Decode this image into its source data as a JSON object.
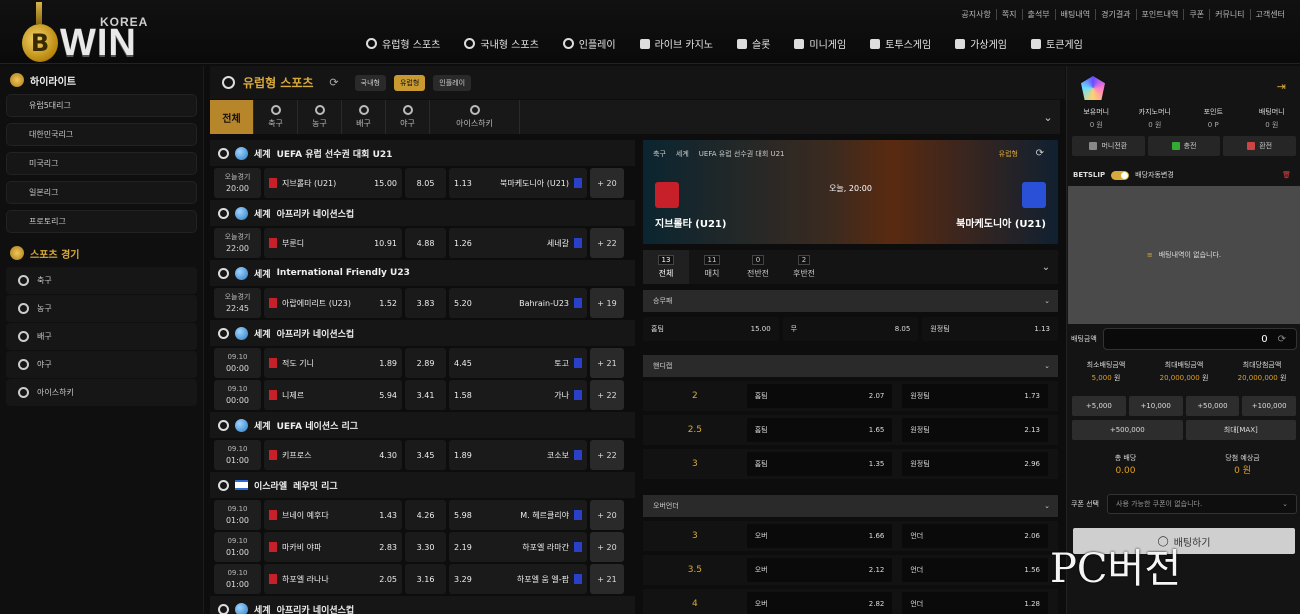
{
  "logo": {
    "badge": "B",
    "small": "KOREA",
    "big": "WIN"
  },
  "util_links": [
    "공지사항",
    "쪽지",
    "출석부",
    "배팅내역",
    "경기결과",
    "포인트내역",
    "쿠폰",
    "커뮤니티",
    "고객센터"
  ],
  "main_nav": [
    "유럽형 스포츠",
    "국내형 스포츠",
    "인플레이",
    "라이브 카지노",
    "슬롯",
    "미니게임",
    "토투스게임",
    "가상게임",
    "토큰게임"
  ],
  "sidebar": {
    "highlight_title": "하이라이트",
    "highlights": [
      "유럽5대리그",
      "대한민국리그",
      "미국리그",
      "일본리그",
      "프로토리그"
    ],
    "sports_title": "스포츠 경기",
    "sports": [
      "축구",
      "농구",
      "배구",
      "야구",
      "아이스하키"
    ]
  },
  "center": {
    "title": "유럽형 스포츠",
    "refresh": "⟳",
    "pills": [
      "국내형",
      "유럽형",
      "인플레이"
    ],
    "sport_tabs": [
      "전체",
      "축구",
      "농구",
      "배구",
      "야구",
      "아이스하키"
    ]
  },
  "leagues": [
    {
      "region": "세계",
      "name": "UEFA 유럽 선수권 대회 U21",
      "flag": "globe",
      "matches": [
        {
          "date": "오늘경기",
          "time": "20:00",
          "home": "지브롤타 (U21)",
          "h": "15.00",
          "d": "8.05",
          "a": "1.13",
          "away": "북마케도니아 (U21)",
          "more": "+ 20"
        }
      ]
    },
    {
      "region": "세계",
      "name": "아프리카 네이션스컵",
      "flag": "globe",
      "matches": [
        {
          "date": "오늘경기",
          "time": "22:00",
          "home": "부룬디",
          "h": "10.91",
          "d": "4.88",
          "a": "1.26",
          "away": "세네갈",
          "more": "+ 22"
        }
      ]
    },
    {
      "region": "세계",
      "name": "International Friendly U23",
      "flag": "globe",
      "matches": [
        {
          "date": "오늘경기",
          "time": "22:45",
          "home": "아랍에미리트 (U23)",
          "h": "1.52",
          "d": "3.83",
          "a": "5.20",
          "away": "Bahrain-U23",
          "more": "+ 19"
        }
      ]
    },
    {
      "region": "세계",
      "name": "아프리카 네이션스컵",
      "flag": "globe",
      "matches": [
        {
          "date": "09.10",
          "time": "00:00",
          "home": "적도 기니",
          "h": "1.89",
          "d": "2.89",
          "a": "4.45",
          "away": "토고",
          "more": "+ 21"
        },
        {
          "date": "09.10",
          "time": "00:00",
          "home": "니제르",
          "h": "5.94",
          "d": "3.41",
          "a": "1.58",
          "away": "가나",
          "more": "+ 22"
        }
      ]
    },
    {
      "region": "세계",
      "name": "UEFA 네이션스 리그",
      "flag": "globe",
      "matches": [
        {
          "date": "09.10",
          "time": "01:00",
          "home": "키프로스",
          "h": "4.30",
          "d": "3.45",
          "a": "1.89",
          "away": "코소보",
          "more": "+ 22"
        }
      ]
    },
    {
      "region": "이스라엘",
      "name": "레우밋 리그",
      "flag": "il",
      "matches": [
        {
          "date": "09.10",
          "time": "01:00",
          "home": "브네이 예후다",
          "h": "1.43",
          "d": "4.26",
          "a": "5.98",
          "away": "M. 헤르클리야",
          "more": "+ 20"
        },
        {
          "date": "09.10",
          "time": "01:00",
          "home": "마카비 야파",
          "h": "2.83",
          "d": "3.30",
          "a": "2.19",
          "away": "하포엘 라마간",
          "more": "+ 20"
        },
        {
          "date": "09.10",
          "time": "01:00",
          "home": "하포엘 라나나",
          "h": "2.05",
          "d": "3.16",
          "a": "3.29",
          "away": "하포엘 움 엘-팜",
          "more": "+ 21"
        }
      ]
    },
    {
      "region": "세계",
      "name": "아프리카 네이션스컵",
      "flag": "globe",
      "matches": []
    }
  ],
  "detail": {
    "sport": "축구",
    "region": "세계",
    "league": "UEFA 유럽 선수권 대회 U21",
    "type": "유럽형",
    "kickoff": "오늘, 20:00",
    "home": "지브롤타 (U21)",
    "away": "북마케도니아 (U21)",
    "tabs": [
      {
        "label": "전체",
        "n": "13"
      },
      {
        "label": "매치",
        "n": "11"
      },
      {
        "label": "전반전",
        "n": "0"
      },
      {
        "label": "후반전",
        "n": "2"
      }
    ],
    "m1_title": "승무패",
    "m1": [
      {
        "l": "홈팀",
        "v": "15.00"
      },
      {
        "l": "무",
        "v": "8.05"
      },
      {
        "l": "원정팀",
        "v": "1.13"
      }
    ],
    "m2_title": "핸디캡",
    "m2": [
      {
        "line": "2",
        "home": "2.07",
        "away": "1.73"
      },
      {
        "line": "2.5",
        "home": "1.65",
        "away": "2.13"
      },
      {
        "line": "3",
        "home": "1.35",
        "away": "2.96"
      }
    ],
    "m3_title": "오버언더",
    "m3": [
      {
        "line": "3",
        "over": "1.66",
        "under": "2.06"
      },
      {
        "line": "3.5",
        "over": "2.12",
        "under": "1.56"
      },
      {
        "line": "4",
        "over": "2.82",
        "under": "1.28"
      }
    ],
    "home_label": "홈팀",
    "away_label": "원정팀",
    "over_label": "오버",
    "under_label": "언더"
  },
  "right": {
    "balances": [
      {
        "l": "보유머니",
        "v": "0 원"
      },
      {
        "l": "카지노머니",
        "v": "0 원"
      },
      {
        "l": "포인트",
        "v": "0 P"
      },
      {
        "l": "배팅머니",
        "v": "0 원"
      }
    ],
    "buttons": [
      "머니전환",
      "충전",
      "환전"
    ],
    "betslip": "BETSLIP",
    "auto_change": "배당자동변경",
    "empty": "배팅내역이 없습니다.",
    "amount_label": "배팅금액",
    "amount": "0",
    "limits": [
      {
        "l": "최소배팅금액",
        "v": "5,000",
        "u": "원"
      },
      {
        "l": "최대배팅금액",
        "v": "20,000,000",
        "u": "원"
      },
      {
        "l": "최대당첨금액",
        "v": "20,000,000",
        "u": "원"
      }
    ],
    "chips": [
      "+5,000",
      "+10,000",
      "+50,000",
      "+100,000"
    ],
    "chips2": [
      "+500,000",
      "최대[MAX]"
    ],
    "totals": [
      {
        "l": "총 배당",
        "v": "0.00"
      },
      {
        "l": "당첨 예상금",
        "v": "0 원"
      }
    ],
    "coupon_label": "쿠폰 선택",
    "coupon_placeholder": "사용 가능한 쿠폰이 없습니다.",
    "bet_button": "배팅하기"
  },
  "watermark": "PC버전"
}
